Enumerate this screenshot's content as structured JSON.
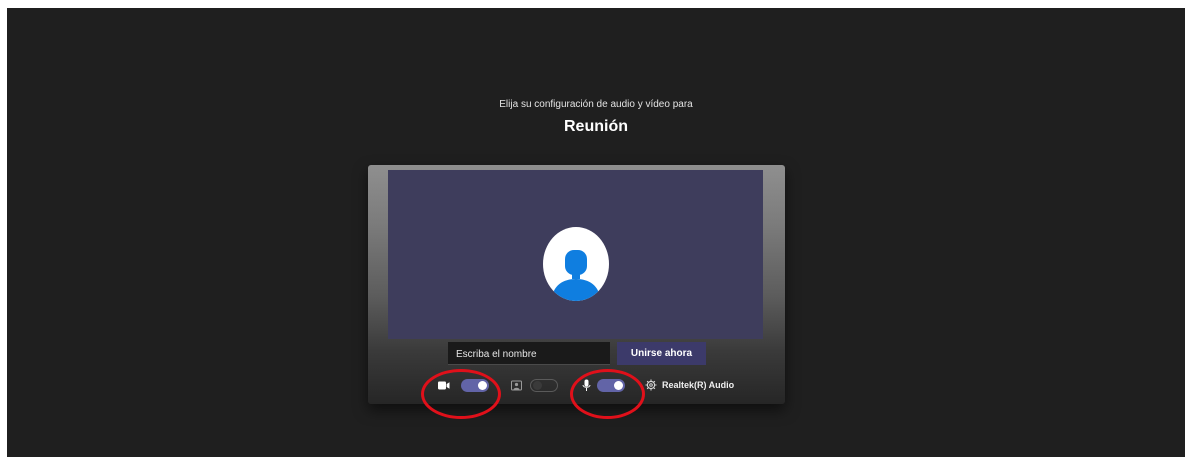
{
  "header": {
    "subtitle": "Elija su configuración de audio y vídeo para",
    "meeting_title": "Reunión"
  },
  "preview": {
    "avatar_icon": "person-icon",
    "background_color": "#3e3d5c"
  },
  "join": {
    "name_placeholder": "Escriba el nombre",
    "name_value": "",
    "join_button_label": "Unirse ahora",
    "join_button_color": "#3c3a6a"
  },
  "controls": {
    "camera": {
      "icon": "camera-icon",
      "on": true
    },
    "background_effects": {
      "icon": "background-blur-icon",
      "on": false
    },
    "microphone": {
      "icon": "microphone-icon",
      "on": true
    },
    "device_settings": {
      "icon": "gear-icon",
      "label": "Realtek(R) Audio"
    },
    "accent_color": "#6264a7"
  },
  "annotations": {
    "color": "#e0101a",
    "highlighted": [
      "camera-toggle",
      "microphone-toggle"
    ]
  }
}
